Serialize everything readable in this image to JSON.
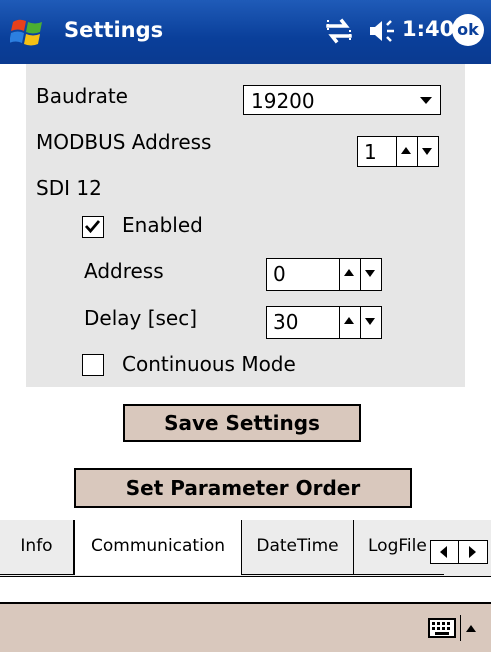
{
  "titlebar": {
    "title": "Settings",
    "time": "1:40",
    "ok_label": "ok",
    "bg_color": "#0a3f9a"
  },
  "settings": {
    "baudrate_label": "Baudrate",
    "baudrate_value": "19200",
    "modbus_label": "MODBUS Address",
    "modbus_value": "1",
    "sdi_label": "SDI 12",
    "enabled_label": "Enabled",
    "enabled_checked": true,
    "address_label": "Address",
    "address_value": "0",
    "delay_label": "Delay [sec]",
    "delay_value": "30",
    "continuous_label": "Continuous Mode",
    "continuous_checked": false
  },
  "buttons": {
    "save_label": "Save Settings",
    "order_label": "Set Parameter Order"
  },
  "tabs": [
    {
      "label": "Info",
      "active": false
    },
    {
      "label": "Communication",
      "active": true
    },
    {
      "label": "DateTime",
      "active": false
    },
    {
      "label": "LogFile",
      "active": false
    }
  ],
  "icons": {
    "start": "windows-flag-icon",
    "connectivity": "connectivity-icon",
    "volume": "speaker-icon",
    "keyboard": "keyboard-icon"
  },
  "colors": {
    "panel": "#e6e6e6",
    "button": "#d9c8bd",
    "menubar": "#d9c8bd"
  }
}
